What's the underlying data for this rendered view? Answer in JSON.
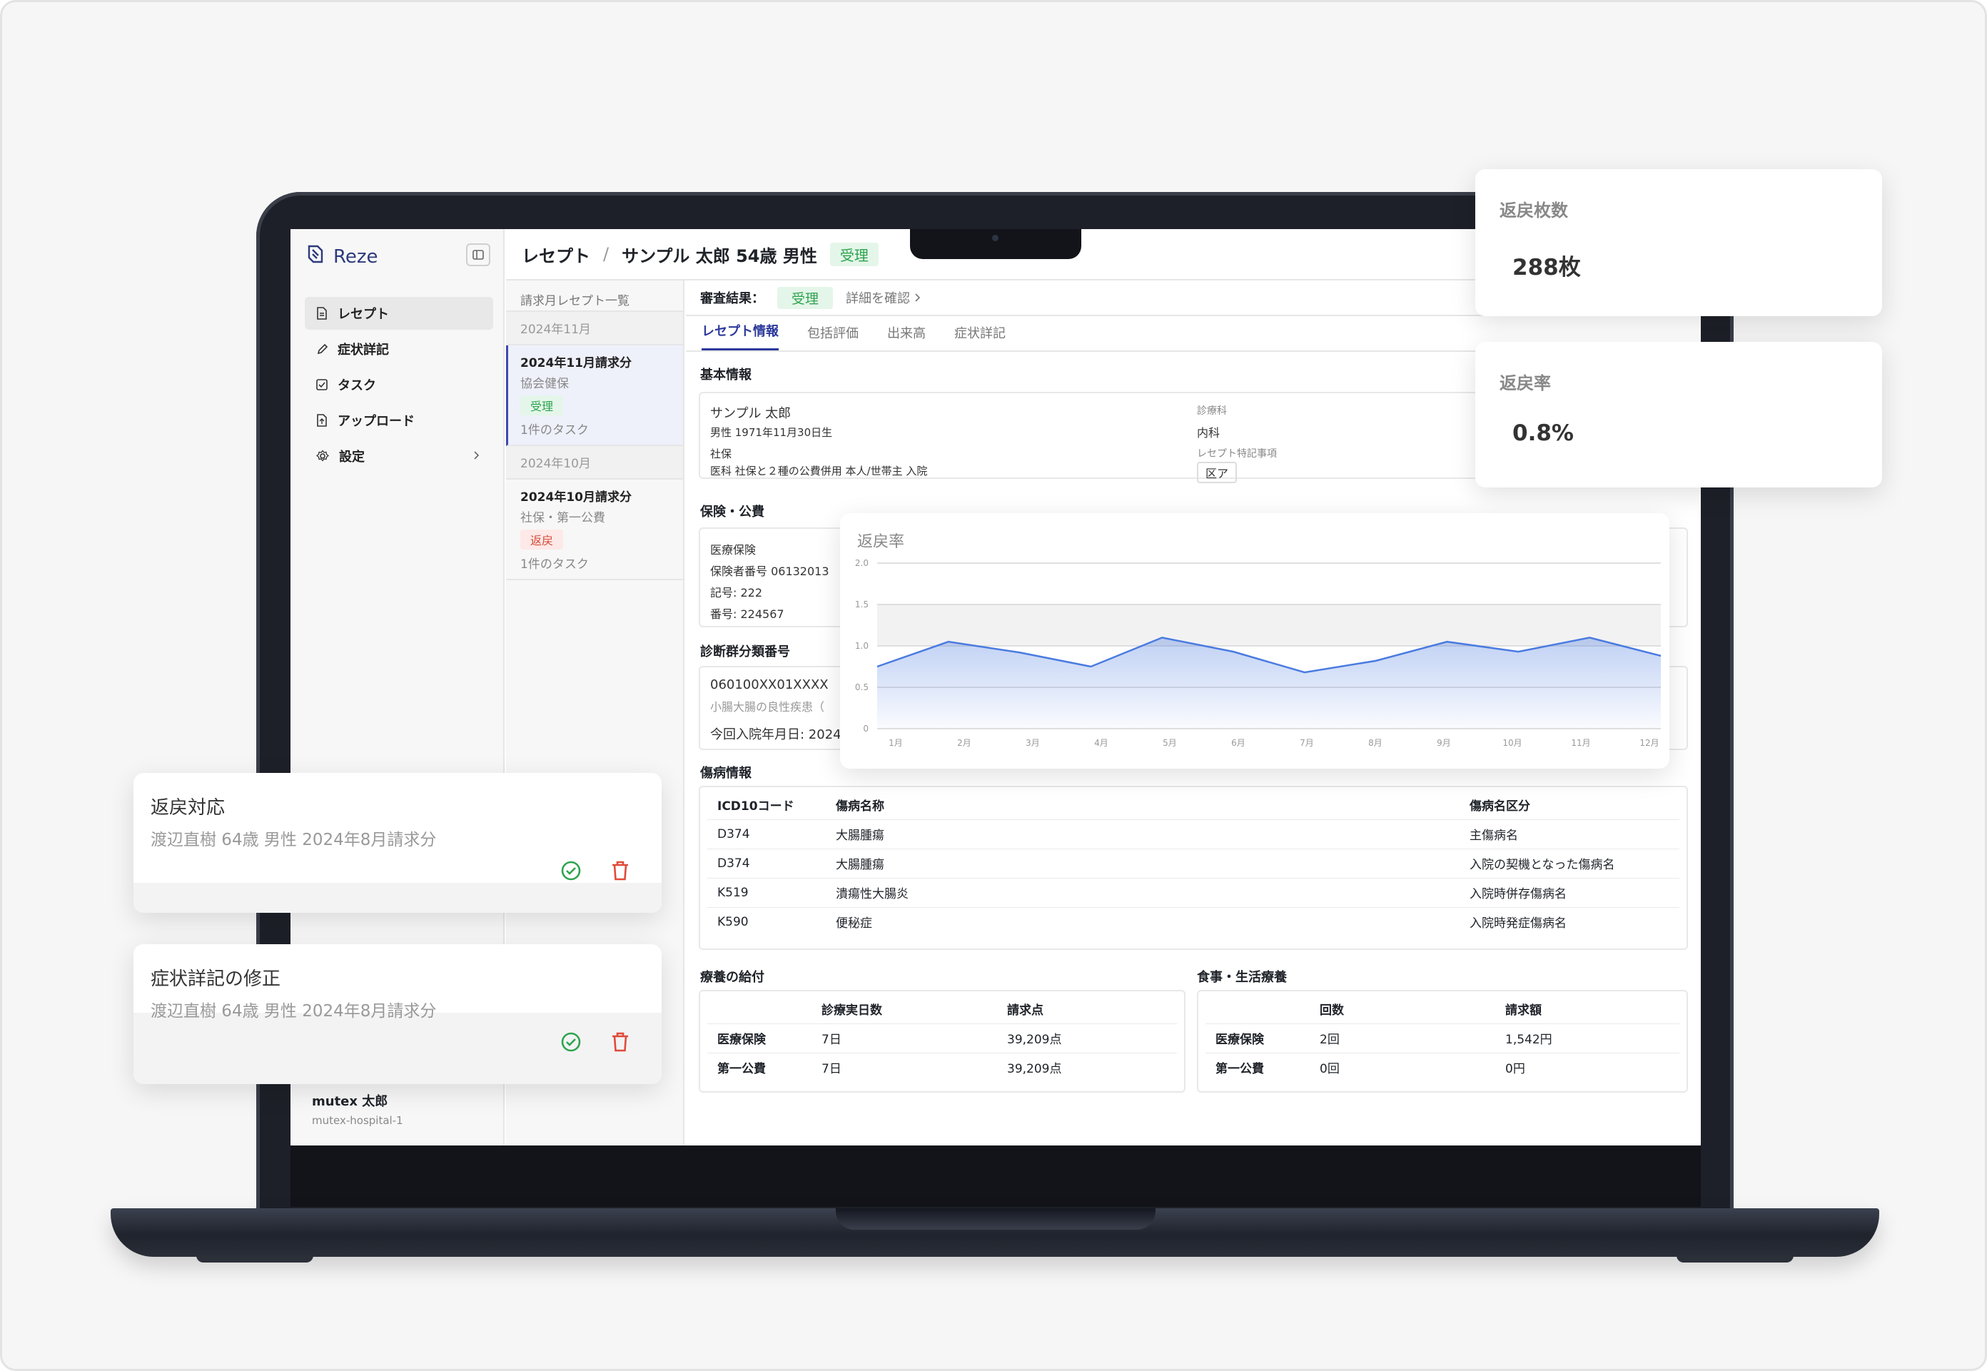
{
  "app": {
    "name": "Reze"
  },
  "sidebar": {
    "items": [
      {
        "label": "レセプト",
        "icon": "document-icon"
      },
      {
        "label": "症状詳記",
        "icon": "pencil-icon"
      },
      {
        "label": "タスク",
        "icon": "checkbox-icon"
      },
      {
        "label": "アップロード",
        "icon": "upload-file-icon"
      },
      {
        "label": "設定",
        "icon": "gear-icon"
      }
    ],
    "user": {
      "name": "mutex 太郎",
      "hospital": "mutex-hospital-1"
    }
  },
  "header": {
    "section": "レセプト",
    "separator": "/",
    "patient": "サンプル 太郎 54歳 男性",
    "status": "受理"
  },
  "list": {
    "title": "請求月レセプト一覧",
    "groups": [
      {
        "month": "2024年11月",
        "item": {
          "title": "2024年11月請求分",
          "insurer": "協会健保",
          "status": "受理",
          "tasks": "1件のタスク"
        }
      },
      {
        "month": "2024年10月",
        "item": {
          "title": "2024年10月請求分",
          "insurer": "社保・第一公費",
          "status": "返戻",
          "tasks": "1件のタスク"
        }
      }
    ]
  },
  "review": {
    "label": "審査結果：",
    "status": "受理",
    "detail_link": "詳細を確認"
  },
  "tabs": [
    "レセプト情報",
    "包括評価",
    "出来高",
    "症状詳記"
  ],
  "basic": {
    "title": "基本情報",
    "name": "サンプル 太郎",
    "gender_birth": "男性  1971年11月30日生",
    "category": "社保",
    "kind": "医科  社保と２種の公費併用  本人/世帯主  入院",
    "dept_label": "診療科",
    "dept": "内科",
    "special_label": "レセプト特記事項",
    "special": "区ア"
  },
  "insurance": {
    "title": "保険・公費",
    "type": "医療保険",
    "insurer_no": "保険者番号  06132013",
    "symbol": "記号: 222",
    "number": "番号: 224567"
  },
  "dpc": {
    "title": "診断群分類番号",
    "code": "060100XX01XXXX",
    "name": "小腸大腸の良性疾患（",
    "admission": "今回入院年月日:  2024"
  },
  "disease": {
    "title": "傷病情報",
    "headers": [
      "ICD10コード",
      "傷病名称",
      "傷病名区分"
    ],
    "rows": [
      [
        "D374",
        "大腸腫瘍",
        "主傷病名"
      ],
      [
        "D374",
        "大腸腫瘍",
        "入院の契機となった傷病名"
      ],
      [
        "K519",
        "潰瘍性大腸炎",
        "入院時併存傷病名"
      ],
      [
        "K590",
        "便秘症",
        "入院時発症傷病名"
      ]
    ]
  },
  "benefit": {
    "title": "療養の給付",
    "headers": [
      "",
      "診療実日数",
      "請求点"
    ],
    "rows": [
      [
        "医療保険",
        "7日",
        "39,209点"
      ],
      [
        "第一公費",
        "7日",
        "39,209点"
      ]
    ]
  },
  "meal": {
    "title": "食事・生活療養",
    "headers": [
      "",
      "回数",
      "請求額"
    ],
    "rows": [
      [
        "医療保険",
        "2回",
        "1,542円"
      ],
      [
        "第一公費",
        "0回",
        "0円"
      ]
    ]
  },
  "stats": [
    {
      "label": "返戻枚数",
      "value": "288枚"
    },
    {
      "label": "返戻率",
      "value": "0.8%"
    }
  ],
  "tasks": [
    {
      "title": "返戻対応",
      "subtitle": "渡辺直樹 64歳 男性   2024年8月請求分"
    },
    {
      "title": "症状詳記の修正",
      "subtitle": "渡辺直樹 64歳 男性   2024年8月請求分"
    }
  ],
  "chart_data": {
    "type": "area",
    "title": "返戻率",
    "categories": [
      "1月",
      "2月",
      "3月",
      "4月",
      "5月",
      "6月",
      "7月",
      "8月",
      "9月",
      "10月",
      "11月",
      "12月"
    ],
    "series": [
      {
        "values": [
          0.75,
          1.05,
          0.92,
          0.75,
          1.1,
          0.93,
          0.68,
          0.82,
          1.05,
          0.93,
          1.1,
          0.88
        ]
      }
    ],
    "ylim": [
      0,
      2.0
    ],
    "yticks": [
      "0",
      "0.5",
      "1.0",
      "1.5",
      "2.0"
    ],
    "color": "#4a7be0",
    "grid": true
  }
}
